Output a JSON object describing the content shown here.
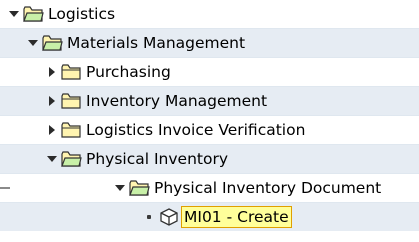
{
  "colors": {
    "row_bg": "#e6ecf3",
    "row_divider": "#dfe7ef",
    "folder_fill": "#fff4b0",
    "folder_stroke": "#333333",
    "open_folder_fill": "#c8f0a8",
    "selection_bg": "#ffff9a",
    "selection_border": "#e0a000"
  },
  "tree": {
    "nodes": [
      {
        "label": "Logistics",
        "state": "expanded",
        "icon": "folder-open-icon"
      },
      {
        "label": "Materials Management",
        "state": "expanded",
        "icon": "folder-open-icon"
      },
      {
        "label": "Purchasing",
        "state": "collapsed",
        "icon": "folder-icon"
      },
      {
        "label": "Inventory Management",
        "state": "collapsed",
        "icon": "folder-icon"
      },
      {
        "label": "Logistics Invoice Verification",
        "state": "collapsed",
        "icon": "folder-icon"
      },
      {
        "label": "Physical Inventory",
        "state": "expanded",
        "icon": "folder-open-icon"
      },
      {
        "label": "Physical Inventory Document",
        "state": "expanded",
        "icon": "folder-open-icon"
      },
      {
        "label": "MI01 - Create",
        "state": "leaf",
        "icon": "transaction-cube-icon",
        "selected": true
      }
    ]
  }
}
